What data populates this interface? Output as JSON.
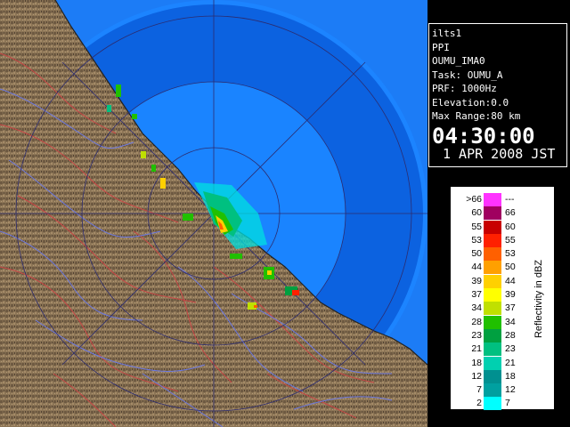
{
  "info": {
    "product": "ilts1",
    "scan_type": "PPI",
    "site": "OUMU_IMA0",
    "task": "Task: OUMU_A",
    "prf": "PRF: 1000Hz",
    "elevation": "Elevation:0.0",
    "max_range": "Max Range:80 km",
    "time": "04:30:00",
    "date": "1 APR 2008 JST"
  },
  "legend": {
    "title": "Reflectivity in dBZ",
    "rows": [
      {
        "lo": ">66",
        "hi": "---",
        "color": "#ff33ff"
      },
      {
        "lo": "60",
        "hi": "66",
        "color": "#a00060"
      },
      {
        "lo": "55",
        "hi": "60",
        "color": "#c80000"
      },
      {
        "lo": "53",
        "hi": "55",
        "color": "#ff2000"
      },
      {
        "lo": "50",
        "hi": "53",
        "color": "#ff6000"
      },
      {
        "lo": "44",
        "hi": "50",
        "color": "#ffa000"
      },
      {
        "lo": "39",
        "hi": "44",
        "color": "#ffd000"
      },
      {
        "lo": "37",
        "hi": "39",
        "color": "#ffff00"
      },
      {
        "lo": "34",
        "hi": "37",
        "color": "#c0e000"
      },
      {
        "lo": "28",
        "hi": "34",
        "color": "#20c000"
      },
      {
        "lo": "23",
        "hi": "28",
        "color": "#00a040"
      },
      {
        "lo": "21",
        "hi": "23",
        "color": "#00c080"
      },
      {
        "lo": "18",
        "hi": "21",
        "color": "#00d0b0"
      },
      {
        "lo": "12",
        "hi": "18",
        "color": "#009090"
      },
      {
        "lo": "7",
        "hi": "12",
        "color": "#00a0a0"
      },
      {
        "lo": "2",
        "hi": "7",
        "color": "#00ffff"
      }
    ]
  },
  "map": {
    "ocean_color": "#0a6cf0",
    "inner_ocean_color": "#1288ff",
    "land_color": "#8a7355",
    "river_color": "#6070d0",
    "border_color": "#c04040",
    "range_ring_color": "#2a2a6a"
  }
}
